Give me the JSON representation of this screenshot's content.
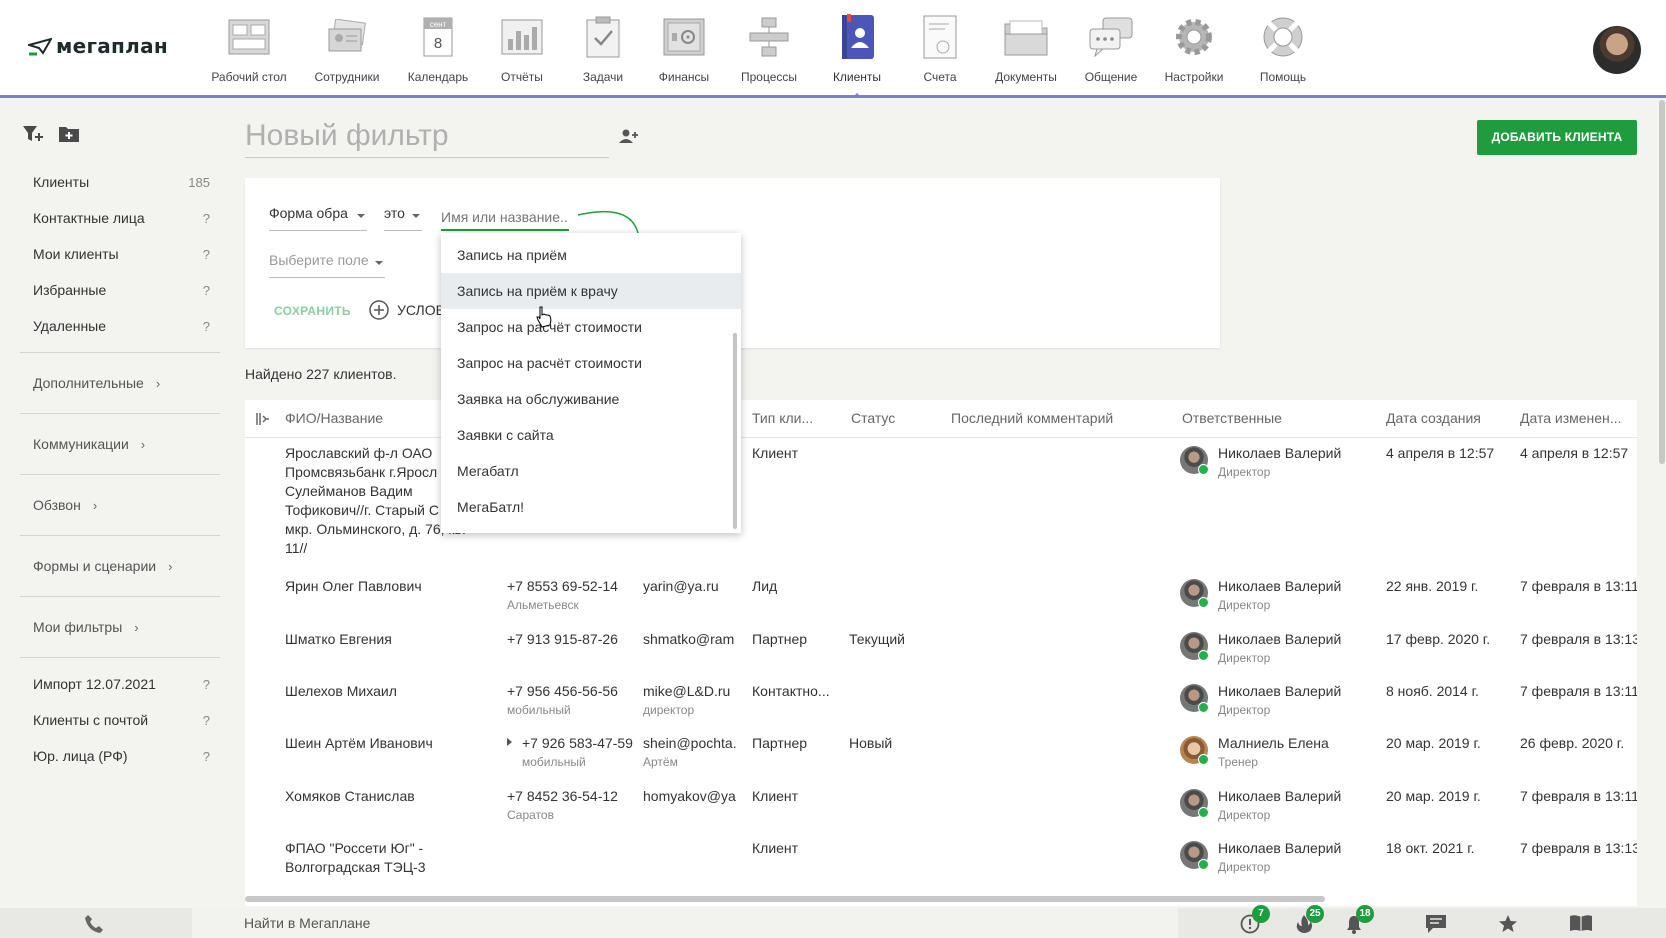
{
  "app": {
    "logo_text": "мегаплан"
  },
  "nav": [
    {
      "label": "Рабочий стол",
      "icon": "desktop-icon"
    },
    {
      "label": "Сотрудники",
      "icon": "employees-icon"
    },
    {
      "label": "Календарь",
      "icon": "calendar-icon",
      "month": "сент",
      "day": "8"
    },
    {
      "label": "Отчёты",
      "icon": "reports-icon"
    },
    {
      "label": "Задачи",
      "icon": "tasks-icon"
    },
    {
      "label": "Финансы",
      "icon": "finance-icon"
    },
    {
      "label": "Процессы",
      "icon": "processes-icon"
    },
    {
      "label": "Клиенты",
      "icon": "clients-icon",
      "active": true
    },
    {
      "label": "Счета",
      "icon": "invoices-icon"
    },
    {
      "label": "Документы",
      "icon": "documents-icon"
    },
    {
      "label": "Общение",
      "icon": "chat-icon"
    },
    {
      "label": "Настройки",
      "icon": "settings-icon"
    },
    {
      "label": "Помощь",
      "icon": "help-icon"
    }
  ],
  "sidebar": {
    "lists": [
      {
        "label": "Клиенты",
        "count": "185"
      },
      {
        "label": "Контактные лица",
        "count": "?"
      },
      {
        "label": "Мои клиенты",
        "count": "?"
      },
      {
        "label": "Избранные",
        "count": "?"
      },
      {
        "label": "Удаленные",
        "count": "?"
      }
    ],
    "groups": [
      {
        "label": "Дополнительные"
      },
      {
        "label": "Коммуникации"
      },
      {
        "label": "Обзвон"
      },
      {
        "label": "Формы и сценарии"
      },
      {
        "label": "Мои фильтры"
      }
    ],
    "filters": [
      {
        "label": "Импорт 12.07.2021",
        "count": "?"
      },
      {
        "label": "Клиенты с почтой",
        "count": "?"
      },
      {
        "label": "Юр. лица (РФ)",
        "count": "?"
      }
    ]
  },
  "header": {
    "filter_title": "Новый фильтр",
    "add_client_button": "ДОБАВИТЬ КЛИЕНТА"
  },
  "filter": {
    "field": "Форма обра",
    "operator": "это",
    "value_placeholder": "Имя или название...",
    "select_field": "Выберите поле",
    "save": "СОХРАНИТЬ",
    "add_condition": "УСЛОВ"
  },
  "dropdown": {
    "items": [
      "Запись на приём",
      "Запись на приём к врачу",
      "Запрос на расчёт стоимости",
      "Запрос на расчёт стоимости",
      "Заявка на обслуживание",
      "Заявки с сайта",
      "Мегабатл",
      "МегаБатл!"
    ],
    "hover_index": 1
  },
  "found_text": "Найдено 227 клиентов.",
  "table": {
    "columns": [
      "ФИО/Название",
      "Тип кли...",
      "Статус",
      "Последний комментарий",
      "Ответственные",
      "Дата создания",
      "Дата изменен..."
    ],
    "rows": [
      {
        "name": [
          "Ярославский ф-л ОАО",
          "Промсвязьбанк г.Яросл",
          "Сулейманов Вадим",
          "Тофикович//г. Старый С",
          "мкр. Ольминского, д. 76, кв.",
          "11//"
        ],
        "phone": "",
        "phone_sub": "",
        "email": "",
        "email_sub": "",
        "type": "Клиент",
        "status": "",
        "resp": "Николаев Валерий",
        "resp_role": "Директор",
        "created": "4 апреля в 12:57",
        "modified": "4 апреля в 12:57"
      },
      {
        "name": [
          "Ярин Олег Павлович"
        ],
        "phone": "+7 8553 69-52-14",
        "phone_sub": "Альметьевск",
        "email": "yarin@ya.ru",
        "email_sub": "",
        "type": "Лид",
        "status": "",
        "resp": "Николаев Валерий",
        "resp_role": "Директор",
        "created": "22 янв. 2019 г.",
        "modified": "7 февраля в 13:11"
      },
      {
        "name": [
          "Шматко Евгения"
        ],
        "phone": "+7 913 915-87-26",
        "phone_sub": "",
        "email": "shmatko@ram",
        "email_sub": "",
        "type": "Партнер",
        "status": "Текущий",
        "resp": "Николаев Валерий",
        "resp_role": "Директор",
        "created": "17 февр. 2020 г.",
        "modified": "7 февраля в 13:13"
      },
      {
        "name": [
          "Шелехов Михаил"
        ],
        "phone": "+7 956 456-56-56",
        "phone_sub": "мобильный",
        "email": "mike@L&D.ru",
        "email_sub": "директор",
        "type": "Контактно...",
        "status": "",
        "resp": "Николаев Валерий",
        "resp_role": "Директор",
        "created": "8 нояб. 2014 г.",
        "modified": "7 февраля в 13:11"
      },
      {
        "name": [
          "Шеин Артём Иванович"
        ],
        "phone": "+7 926 583-47-59",
        "phone_sub": "мобильный",
        "email": "shein@pochta.",
        "email_sub": "Артём",
        "type": "Партнер",
        "status": "Новый",
        "resp": "Малниель Елена",
        "resp_role": "Тренер",
        "created": "20 мар. 2019 г.",
        "modified": "26 февр. 2020 г."
      },
      {
        "name": [
          "Хомяков Станислав"
        ],
        "phone": "+7 8452 36-54-12",
        "phone_sub": "Саратов",
        "email": "homyakov@ya",
        "email_sub": "",
        "type": "Клиент",
        "status": "",
        "resp": "Николаев Валерий",
        "resp_role": "Директор",
        "created": "20 мар. 2019 г.",
        "modified": "7 февраля в 13:11"
      },
      {
        "name": [
          "ФПАО \"Россети Юг\" -",
          "Волгоградская ТЭЦ-3"
        ],
        "phone": "",
        "phone_sub": "",
        "email": "",
        "email_sub": "",
        "type": "Клиент",
        "status": "",
        "resp": "Николаев Валерий",
        "resp_role": "Директор",
        "created": "18 окт. 2021 г.",
        "modified": "7 февраля в 13:13"
      }
    ]
  },
  "bottom": {
    "search_placeholder": "Найти в Мегаплане",
    "badges": {
      "alerts": "7",
      "hot": "25",
      "notifications": "18"
    }
  },
  "colors": {
    "accent": "#1f9c3e",
    "nav_underline": "#7b80c9",
    "clients_icon": "#4a56b8"
  }
}
